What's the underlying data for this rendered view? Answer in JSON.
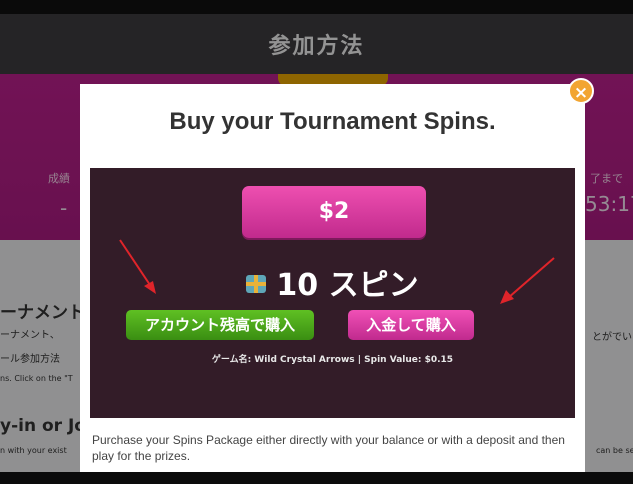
{
  "header": {
    "title": "参加方法"
  },
  "background": {
    "left_small": "成績",
    "left_dash": "-",
    "right_small": "了まで",
    "right_big": "53:17",
    "section_heading": "ーナメント",
    "line1": "ーナメント、",
    "line2": "ール参加方法",
    "line3": "ns. Click on the \"T",
    "right_text": "とがでい",
    "heading2": "y-in or Jo",
    "line4": "n with your exist",
    "right_text2": "can be see"
  },
  "modal": {
    "title": "Buy your Tournament Spins.",
    "price": "$2",
    "spins_text": "10 スピン",
    "buy_with_balance": "アカウント残高で購入",
    "buy_with_deposit": "入金して購入",
    "game_info": "ゲーム名: Wild Crystal Arrows | Spin Value: $0.15",
    "description": "Purchase your Spins Package either directly with your balance or with a deposit and then play for the prizes.",
    "close_symbol": "×"
  },
  "colors": {
    "header_bg": "#3c3a3e",
    "pink_band": "#b81f8a",
    "panel_bg": "#331c28",
    "green_button": "#4aa51a",
    "pink_button": "#e040a8",
    "close_orange": "#f2a531",
    "arrow_red": "#e0242a"
  },
  "icons": [
    "gift-icon",
    "close-icon",
    "annotation-arrow"
  ]
}
